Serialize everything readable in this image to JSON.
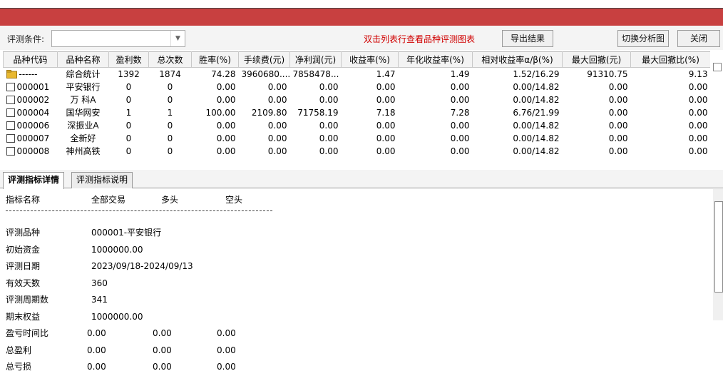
{
  "toolbar": {
    "condition_label": "评测条件:",
    "condition_value": "",
    "hint": "双击列表行查看品种评测图表",
    "export_label": "导出结果",
    "switch_label": "切换分析图",
    "close_label": "关闭"
  },
  "table": {
    "headers": [
      "品种代码",
      "品种名称",
      "盈利数",
      "总次数",
      "胜率(%)",
      "手续费(元)",
      "净利润(元)",
      "收益率(%)",
      "年化收益率(%)",
      "相对收益率α/β(%)",
      "最大回撤(元)",
      "最大回撤比(%)"
    ],
    "rows": [
      {
        "code": "------",
        "name": "综合统计",
        "win": "1392",
        "total": "1874",
        "rate": "74.28",
        "fee": "3960680....",
        "profit": "7858478...",
        "ret": "1.47",
        "annual": "1.49",
        "ab": "1.52/16.29",
        "dd": "91310.75",
        "ddr": "9.13",
        "icon": "folder-icon"
      },
      {
        "code": "000001",
        "name": "平安银行",
        "win": "0",
        "total": "0",
        "rate": "0.00",
        "fee": "0.00",
        "profit": "0.00",
        "ret": "0.00",
        "annual": "0.00",
        "ab": "0.00/14.82",
        "dd": "0.00",
        "ddr": "0.00",
        "icon": "checkbox"
      },
      {
        "code": "000002",
        "name": "万 科A",
        "win": "0",
        "total": "0",
        "rate": "0.00",
        "fee": "0.00",
        "profit": "0.00",
        "ret": "0.00",
        "annual": "0.00",
        "ab": "0.00/14.82",
        "dd": "0.00",
        "ddr": "0.00",
        "icon": "checkbox"
      },
      {
        "code": "000004",
        "name": "国华网安",
        "win": "1",
        "total": "1",
        "rate": "100.00",
        "fee": "2109.80",
        "profit": "71758.19",
        "ret": "7.18",
        "annual": "7.28",
        "ab": "6.76/21.99",
        "dd": "0.00",
        "ddr": "0.00",
        "icon": "checkbox"
      },
      {
        "code": "000006",
        "name": "深振业A",
        "win": "0",
        "total": "0",
        "rate": "0.00",
        "fee": "0.00",
        "profit": "0.00",
        "ret": "0.00",
        "annual": "0.00",
        "ab": "0.00/14.82",
        "dd": "0.00",
        "ddr": "0.00",
        "icon": "checkbox"
      },
      {
        "code": "000007",
        "name": "全新好",
        "win": "0",
        "total": "0",
        "rate": "0.00",
        "fee": "0.00",
        "profit": "0.00",
        "ret": "0.00",
        "annual": "0.00",
        "ab": "0.00/14.82",
        "dd": "0.00",
        "ddr": "0.00",
        "icon": "checkbox"
      },
      {
        "code": "000008",
        "name": "神州高铁",
        "win": "0",
        "total": "0",
        "rate": "0.00",
        "fee": "0.00",
        "profit": "0.00",
        "ret": "0.00",
        "annual": "0.00",
        "ab": "0.00/14.82",
        "dd": "0.00",
        "ddr": "0.00",
        "icon": "checkbox"
      }
    ]
  },
  "tabs": {
    "active": "评测指标详情",
    "inactive": "评测指标说明"
  },
  "detail": {
    "header": {
      "name": "指标名称",
      "all": "全部交易",
      "long": "多头",
      "short": "空头"
    },
    "items": [
      {
        "label": "评测品种",
        "v1": "000001-平安银行",
        "v2": "",
        "v3": ""
      },
      {
        "label": "初始资金",
        "v1": "1000000.00",
        "v2": "",
        "v3": ""
      },
      {
        "label": "评测日期",
        "v1": "2023/09/18-2024/09/13",
        "v2": "",
        "v3": ""
      },
      {
        "label": "有效天数",
        "v1": "360",
        "v2": "",
        "v3": ""
      },
      {
        "label": "评测周期数",
        "v1": "341",
        "v2": "",
        "v3": ""
      },
      {
        "label": "期末权益",
        "v1": "1000000.00",
        "v2": "",
        "v3": ""
      },
      {
        "label": "盈亏时间比",
        "v1": "0.00",
        "v2": "0.00",
        "v3": "0.00"
      },
      {
        "label": "总盈利",
        "v1": "0.00",
        "v2": "0.00",
        "v3": "0.00"
      },
      {
        "label": "总亏损",
        "v1": "0.00",
        "v2": "0.00",
        "v3": "0.00"
      }
    ]
  },
  "colors": {
    "titlebar": "#c84040",
    "hint": "#d00000"
  }
}
